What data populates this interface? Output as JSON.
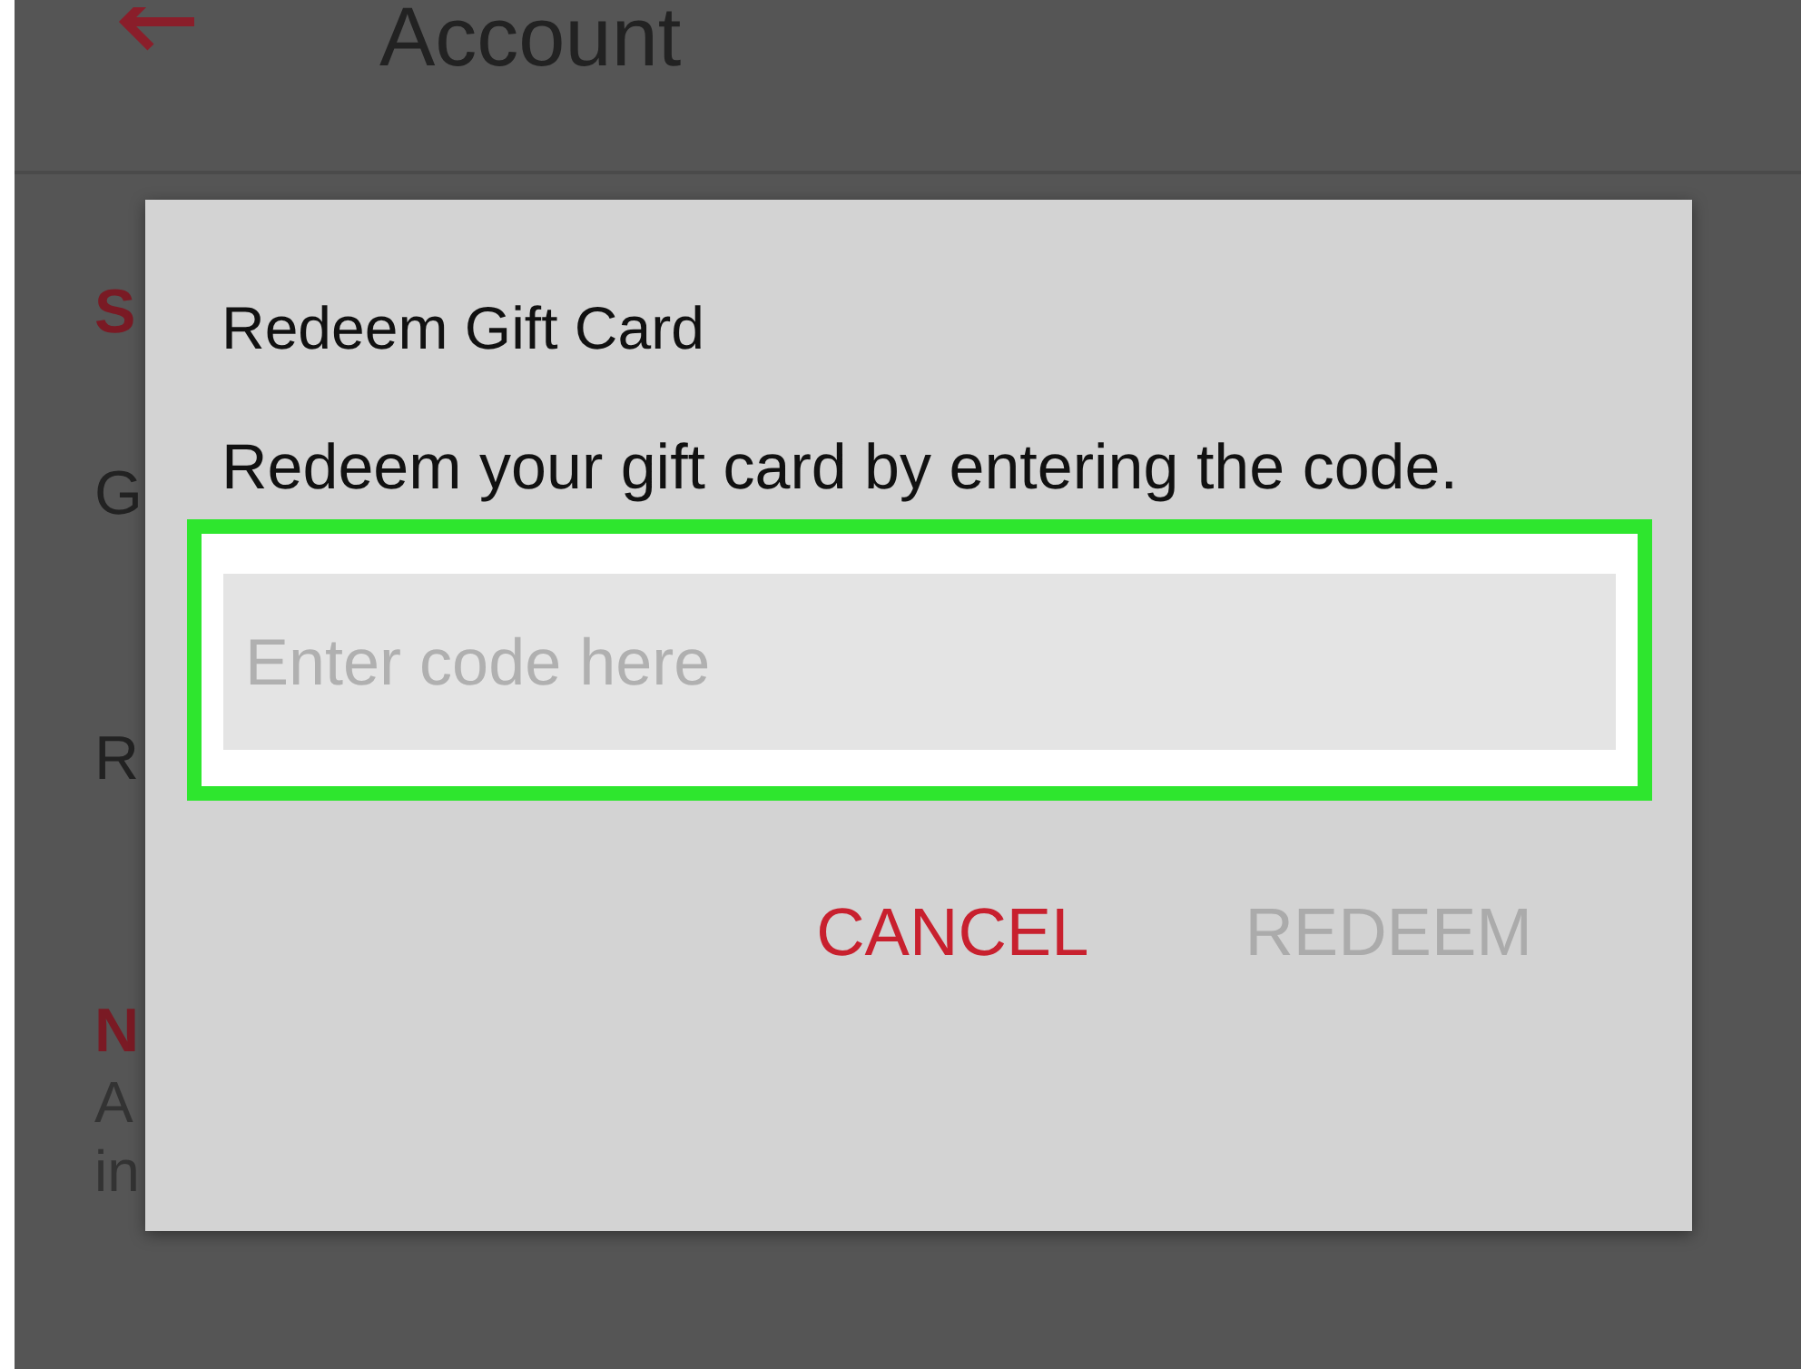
{
  "header": {
    "title": "Account"
  },
  "background_rows": [
    {
      "text": "S",
      "kind": "section"
    },
    {
      "text": "G",
      "kind": "item"
    },
    {
      "text": "R",
      "kind": "item"
    },
    {
      "text": "N",
      "kind": "section"
    },
    {
      "text": "A",
      "kind": "detail"
    },
    {
      "text": "in",
      "kind": "detail"
    }
  ],
  "dialog": {
    "title": "Redeem Gift Card",
    "message": "Redeem your gift card by entering the code.",
    "field": {
      "placeholder": "Enter code here"
    },
    "buttons": [
      {
        "label": "CANCEL",
        "disabled": false
      },
      {
        "label": "REDEEM",
        "disabled": true
      }
    ]
  }
}
